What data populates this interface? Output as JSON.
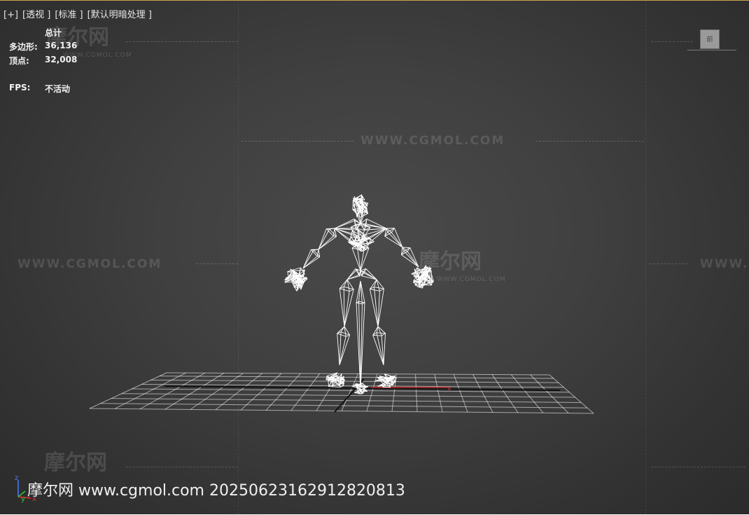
{
  "viewport": {
    "labels": [
      "[+]",
      "[透视 ]",
      "[标准 ]",
      "[默认明暗处理 ]"
    ],
    "stats": {
      "header": "总计",
      "polygons_label": "多边形:",
      "polygons_value": "36,136",
      "vertices_label": "顶点:",
      "vertices_value": "32,008",
      "fps_label": "FPS:",
      "fps_value": "不活动"
    },
    "viewcube_text": "前",
    "accent_color": "#c9a34a"
  },
  "watermarks": {
    "site_text": "WWW.CGMOL.COM",
    "logo_text": "摩尔网",
    "logo_sub": "WWW.CGMOL.COM",
    "footer": "摩尔网 www.cgmol.com 20250623162912820813"
  },
  "axes": {
    "x": "x",
    "y": "y",
    "z": "z"
  }
}
